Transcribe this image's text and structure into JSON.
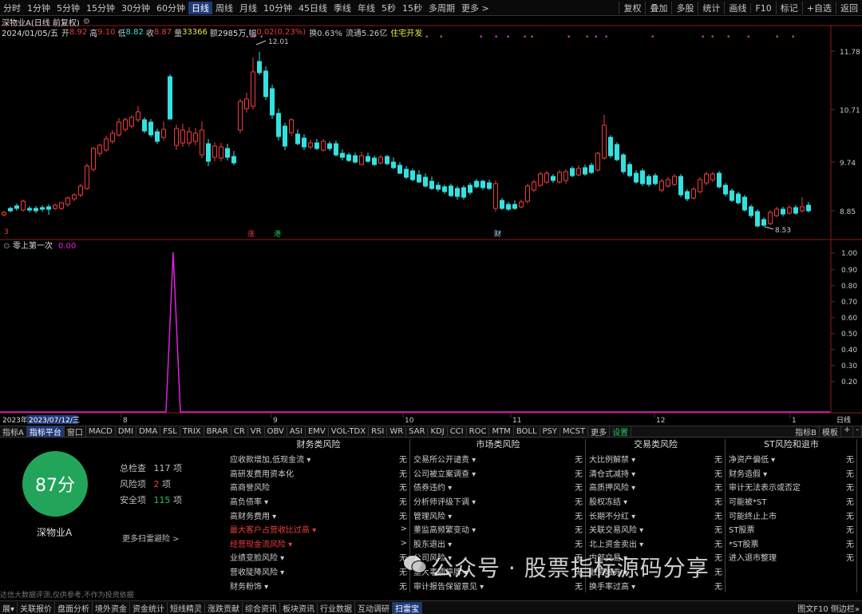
{
  "toolbar": {
    "periods": [
      "分时",
      "1分钟",
      "5分钟",
      "15分钟",
      "30分钟",
      "60分钟",
      "日线",
      "周线",
      "月线",
      "10分钟",
      "45日线",
      "季线",
      "年线",
      "5秒",
      "15秒",
      "多周期",
      "更多 >"
    ],
    "active_period": "日线",
    "right": [
      "复权",
      "叠加",
      "多股",
      "统计",
      "画线",
      "F10",
      "标记",
      "+自选",
      "返回"
    ]
  },
  "chart_header": {
    "title": "深物业A(日线 前复权)",
    "date": "2024/01/05/五",
    "open_label": "开",
    "open": "8.92",
    "high_label": "高",
    "high": "9.10",
    "low_label": "低",
    "low": "8.82",
    "close_label": "收",
    "close": "8.87",
    "vol_label": "量",
    "vol": "33366",
    "amt_label": "额",
    "amt": "2985万",
    "chg_label": "幅",
    "chg": "0.02(0.23%)",
    "turnover": "换0.63%",
    "float_cap": "流通5.26亿",
    "sector": "住宅开发"
  },
  "price_axis": [
    "11.78",
    "10.71",
    "9.74",
    "8.85"
  ],
  "annotations": {
    "high": "12.01",
    "low": "8.53"
  },
  "event_tags": [
    "3",
    "涨",
    "港",
    "财"
  ],
  "indicator": {
    "name": "零上第一次",
    "value": "0.00",
    "axis": [
      "1.00",
      "0.90",
      "0.80",
      "0.70",
      "0.60",
      "0.50",
      "0.40",
      "0.30",
      "0.20"
    ]
  },
  "time_axis": {
    "start": "2023年",
    "date": "2023/07/12/三",
    "months": [
      "8",
      "9",
      "10",
      "11",
      "12",
      "1"
    ],
    "right_label": "日线"
  },
  "tabs": [
    "指标A",
    "指标平台",
    "窗口",
    "MACD",
    "DMI",
    "DMA",
    "FSL",
    "TRIX",
    "BRAR",
    "CR",
    "VR",
    "OBV",
    "ASI",
    "EMV",
    "VOL-TDX",
    "RSI",
    "WR",
    "SAR",
    "KDJ",
    "CCI",
    "ROC",
    "MTM",
    "BOLL",
    "PSY",
    "MCST",
    "更多",
    "设置"
  ],
  "tabs_right": [
    "指标B",
    "模板",
    "+",
    "-"
  ],
  "panel": {
    "score": "87分",
    "stock": "深物业A",
    "total_label": "总检查",
    "total": "117",
    "total_unit": "项",
    "risk_label": "风险项",
    "risk": "2",
    "risk_unit": "项",
    "safe_label": "安全项",
    "safe": "115",
    "safe_unit": "项",
    "more": "更多扫雷避险 >",
    "disclaimer": "达信大数据评测,仅供参考,不作为投资依据",
    "columns": [
      {
        "title": "财务类风险",
        "rows": [
          {
            "name": "应收款增加,低现金流 ▾",
            "val": "无",
            "red": false
          },
          {
            "name": "高研发费用资本化",
            "val": "无",
            "red": false
          },
          {
            "name": "高商誉风险",
            "val": "无",
            "red": false
          },
          {
            "name": "高负债率 ▾",
            "val": "无",
            "red": false
          },
          {
            "name": "高财务费用 ▾",
            "val": "无",
            "red": false
          },
          {
            "name": "最大客户占营收比过高 ▾",
            "val": ">",
            "red": true
          },
          {
            "name": "经营现金流风险 ▾",
            "val": ">",
            "red": true
          },
          {
            "name": "业绩变脸风险 ▾",
            "val": "无",
            "red": false
          },
          {
            "name": "营收陡降风险 ▾",
            "val": "无",
            "red": false
          },
          {
            "name": "财务粉饰 ▾",
            "val": "无",
            "red": false
          }
        ]
      },
      {
        "title": "市场类风险",
        "rows": [
          {
            "name": "交易所公开谴责 ▾",
            "val": "无",
            "red": false
          },
          {
            "name": "公司被立案调查 ▾",
            "val": "无",
            "red": false
          },
          {
            "name": "债券违约 ▾",
            "val": "无",
            "red": false
          },
          {
            "name": "分析师评级下调 ▾",
            "val": "无",
            "red": false
          },
          {
            "name": "管理风险 ▾",
            "val": "无",
            "red": false
          },
          {
            "name": "董监高频繁变动 ▾",
            "val": "无",
            "red": false
          },
          {
            "name": "股东退出 ▾",
            "val": "无",
            "red": false
          },
          {
            "name": "公司风险 ▾",
            "val": "无",
            "red": false
          },
          {
            "name": "重大事项停牌 ▾",
            "val": "无",
            "red": false
          },
          {
            "name": "审计报告保留意见 ▾",
            "val": "无",
            "red": false
          }
        ]
      },
      {
        "title": "交易类风险",
        "rows": [
          {
            "name": "大比例解禁 ▾",
            "val": "无",
            "red": false
          },
          {
            "name": "清仓式减持 ▾",
            "val": "无",
            "red": false
          },
          {
            "name": "高质押风险 ▾",
            "val": "无",
            "red": false
          },
          {
            "name": "股权冻结 ▾",
            "val": "无",
            "red": false
          },
          {
            "name": "长期不分红 ▾",
            "val": "无",
            "red": false
          },
          {
            "name": "关联交易风险 ▾",
            "val": "无",
            "red": false
          },
          {
            "name": "北上资金卖出 ▾",
            "val": "无",
            "red": false
          },
          {
            "name": "内部交易 ▾",
            "val": "无",
            "red": false
          },
          {
            "name": "融资融券 ▾",
            "val": "无",
            "red": false
          },
          {
            "name": "换手率过高 ▾",
            "val": "无",
            "red": false
          }
        ]
      },
      {
        "title": "ST风险和退市",
        "rows": [
          {
            "name": "净资产偏低 ▾",
            "val": "无",
            "red": false
          },
          {
            "name": "财务造假 ▾",
            "val": "无",
            "red": false
          },
          {
            "name": "审计无法表示或否定",
            "val": "无",
            "red": false
          },
          {
            "name": "可能被*ST",
            "val": "无",
            "red": false
          },
          {
            "name": "可能终止上市",
            "val": "无",
            "red": false
          },
          {
            "name": "ST股票",
            "val": "无",
            "red": false
          },
          {
            "name": "*ST股票",
            "val": "无",
            "red": false
          },
          {
            "name": "进入退市整理",
            "val": "无",
            "red": false
          },
          {
            "name": "",
            "val": "",
            "red": false
          },
          {
            "name": "",
            "val": "",
            "red": false
          }
        ]
      }
    ]
  },
  "footer": [
    "展▾",
    "关联报价",
    "盘面分析",
    "境外资金",
    "资金统计",
    "短线精灵",
    "涨跌贡献",
    "综合资讯",
    "板块资讯",
    "行业数据",
    "互动调研",
    "扫雷宝"
  ],
  "footer_active": "扫雷宝",
  "footer_right": "图文F10 侧边栏»",
  "watermark": "公众号 · 股票指标源码分享",
  "colors": {
    "up": "#f03c3c",
    "down": "#34e0e0",
    "indicator": "#e020e0",
    "score": "#22a55a"
  }
}
